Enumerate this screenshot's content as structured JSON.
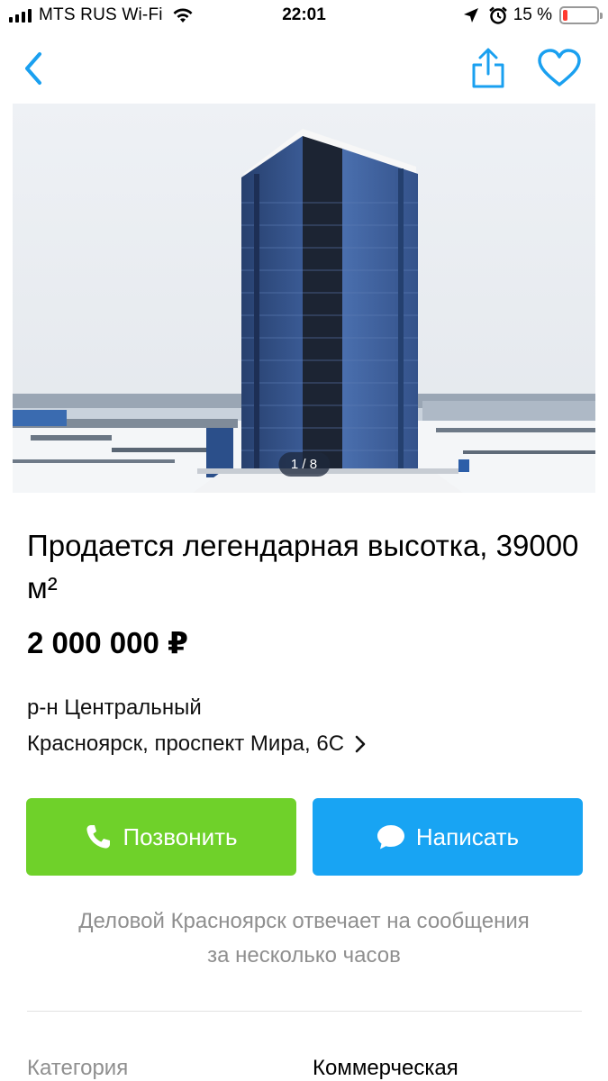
{
  "status_bar": {
    "carrier": "MTS RUS Wi-Fi",
    "time": "22:01",
    "battery_percent": "15 %",
    "battery_level": 0.15,
    "icons": [
      "signal-icon",
      "wifi-icon",
      "location-arrow-icon",
      "alarm-icon",
      "battery-icon"
    ]
  },
  "nav": {
    "icons": [
      "back-icon",
      "share-icon",
      "heart-icon"
    ],
    "accent_color": "#1aa0f0"
  },
  "gallery": {
    "counter": "1 / 8"
  },
  "listing": {
    "title": "Продается легендарная высотка, 39000 м²",
    "price": "2 000 000 ₽",
    "district": "р-н Центральный",
    "address": "Красноярск, проспект Мира, 6С"
  },
  "actions": {
    "call_label": "Позвонить",
    "write_label": "Написать",
    "call_color": "#6fd12a",
    "write_color": "#18a4f3"
  },
  "seller_note": {
    "line1": "Деловой Красноярск отвечает на сообщения",
    "line2": "за несколько часов"
  },
  "params": [
    {
      "label": "Категория",
      "value": "Коммерческая"
    }
  ]
}
